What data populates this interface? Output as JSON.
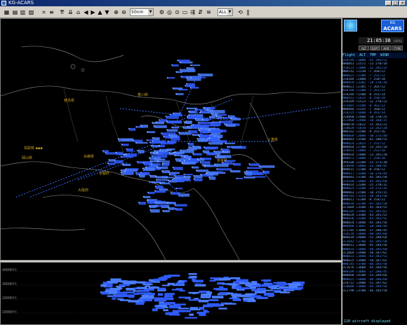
{
  "window": {
    "title": "KG-ACARS"
  },
  "toolbar": {
    "range_value": "50nm",
    "filter_value": "ALL"
  },
  "map": {
    "places": [
      {
        "name": "Shimane"
      },
      {
        "name": "Tottori"
      },
      {
        "name": "Hyogo"
      },
      {
        "name": "Osaka"
      },
      {
        "name": "Kyoto"
      },
      {
        "name": "Nara"
      },
      {
        "name": "Wakayama"
      },
      {
        "name": "Tokushima"
      },
      {
        "name": "Kagawa"
      },
      {
        "name": "Okayama"
      },
      {
        "name": "Shiga"
      },
      {
        "name": "Mie"
      },
      {
        "name": "Fukui"
      }
    ]
  },
  "profile": {
    "alt_labels": [
      "40000ft",
      "30000ft",
      "20000ft",
      "10000ft"
    ]
  },
  "side": {
    "logo_top": "KG",
    "logo_bottom": "ACARS",
    "clock": "21:05:38",
    "clock_suffix": "LOCAL",
    "modes": [
      "ALT",
      "DEPT",
      "ARR",
      "TYPE"
    ],
    "list_header": "Flight  ALT  TMP  WIND",
    "flights": [
      "JL0749 ↑3000 -55 285/52",
      "NH0061 ↓1572 -13 270/18",
      "JL0123 ↓1000 -12 265/15",
      "NH0142 ↑1230 -7 260/12",
      "NH0021 ↑1100 -7 255/12",
      "JL0204 ↓1000 -7 250/10",
      "NH0059 ↓3302 -18 270/18",
      "NH0021 ↓1105 -7 265/12",
      "KE0706 ↑1100 -7 255/12",
      "JL0184 ↑1500 -8 255/14",
      "NH0412 ↑1615 -8 250/18",
      "JL0209 ↑1523 -12 270/22",
      "JL1601 ↑1500 -8 262/12",
      "NH0084 ↑1235 -7 260/12",
      "JL0215 ↑1600 -9 265/14",
      "JL0060 ↑2400 -18 270/25",
      "JL1960 ↑2400 -18 268/25",
      "NH0070 ↑2012 -15 262/22",
      "JL0028 ↑1870 -13 262/20",
      "NH0162 ↑1500 -9 255/16",
      "NH0069 ↓3000 -30 275/40",
      "NH0003 ↑3500 -42 280/55",
      "NH0024 ↓1015 -7 255/12",
      "NH0064 ↓1700 -13 265/18",
      "JL0031 ↑1000 -7 252/10",
      "NH0054 ↓1800 -13 265/20",
      "NH0072 ↑1000 -7 250/10",
      "UP8108 ↓2100 -25 273/30",
      "JL0094 ↑3000 -32 280/45",
      "NH0015 ↑1100 -8 258/12",
      "NH0017 ↓3200 -36 276/44",
      "NH0002 ↑3700 -45 285/58",
      "JL0168 ↑3800 -45 285/60",
      "NH0014 ↓2300 -25 270/32",
      "NH0025 ↑2500 -29 272/35",
      "NH0063 ↓1500 -10 255/15",
      "NH0703 ↑3264 -38 283/50",
      "NH0011 ↑1200 -8 258/12",
      "NH0034 ↑3700 -45 283/58",
      "JL1604 ↓3500 -45 283/55",
      "NH0105 ↓3900 -51 285/62",
      "NH0028 ↓3300 -43 281/52",
      "NH0036 ↑3300 -43 281/52",
      "NH0054 ↑3600 -45 283/56",
      "NH0868 ↓3092 -38 280/48",
      "JL1785 ↑3000 -37 280/45",
      "JL0134 ↑3800 -48 285/60",
      "NH0039 ↓4000 -52 288/64",
      "JL1042 ↑3700 -45 285/58",
      "NH0012 ↓3600 -45 284/56",
      "NH0014 ↑3800 -48 285/60",
      "JL1069 ↓3900 -50 287/62",
      "NH0022 ↓3400 -43 282/53",
      "NH0625 ↑3900 -50 287/62",
      "NH0145 ↑3700 -46 285/58",
      "JL1676 ↓3600 -45 284/56",
      "NH0109 ↑3000 -37 280/45",
      "NH0068 ↓4100 -53 289/66",
      "NH0015 ↑3800 -48 286/60",
      "JL0712 ↓3900 -51 287/62",
      "JL0086 ↑3600 -45 284/56",
      "JL1798 ↓3700 -46 285/58"
    ],
    "footer": "120 aircraft displayed"
  }
}
